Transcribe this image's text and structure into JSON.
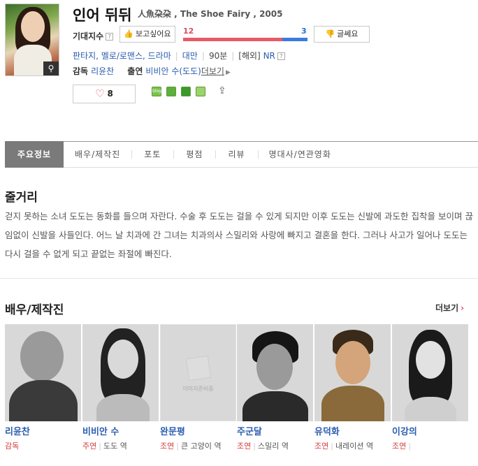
{
  "movie": {
    "title": "인어 뒤뒤",
    "subtitle": "人魚朶朶 , The Shoe Fairy , 2005",
    "expect_label": "기대지수",
    "want_label": "보고싶어요",
    "meh_label": "글쎄요",
    "want_count": "12",
    "meh_count": "3",
    "want_ratio": 0.8,
    "genres": "판타지, 멜로/로맨스, 드라마",
    "country": "대만",
    "runtime": "90분",
    "rating_prefix": "[해외]",
    "rating": "NR",
    "director_label": "감독",
    "director": "리윤찬",
    "cast_label": "출연",
    "cast_list": "비비안 수(도도)",
    "more_label": "더보기",
    "like_count": "8"
  },
  "share_icons": [
    "blog-icon",
    "cafe-icon",
    "bookmark-icon",
    "memo-icon",
    "share-out-icon"
  ],
  "tabs": [
    "주요정보",
    "배우/제작진",
    "포토",
    "평점",
    "리뷰",
    "명대사/연관영화"
  ],
  "synopsis": {
    "heading": "줄거리",
    "text": "걷지 못하는 소녀 도도는 동화를 들으며 자란다. 수술 후 도도는 걸을 수 있게 되지만 이후 도도는 신발에 과도한 집착을 보이며 끊임없이 신발을 사들인다. 어느 날 치과에 간 그녀는 치과의사 스밀리와 사랑에 빠지고 결혼을 한다. 그러나 사고가 일어나 도도는 다시 걸을 수 없게 되고 끝없는 좌절에 빠진다."
  },
  "cast_section": {
    "heading": "배우/제작진",
    "more": "더보기",
    "no_image_text": "이미지준비중",
    "people": [
      {
        "name": "리윤찬",
        "role": "감독",
        "character": ""
      },
      {
        "name": "비비안 수",
        "role": "주연",
        "character": "도도 역"
      },
      {
        "name": "완문평",
        "role": "조연",
        "character": "큰 고양이 역"
      },
      {
        "name": "주군달",
        "role": "조연",
        "character": "스밀리 역"
      },
      {
        "name": "유덕화",
        "role": "조연",
        "character": "내레이션 역"
      },
      {
        "name": "이강의",
        "role": "조연",
        "character": ""
      }
    ]
  },
  "colors": {
    "accent_red": "#e04a5a",
    "accent_blue": "#2b6fd6",
    "link": "#2a5db0",
    "active_tab": "#7a7a7a"
  }
}
